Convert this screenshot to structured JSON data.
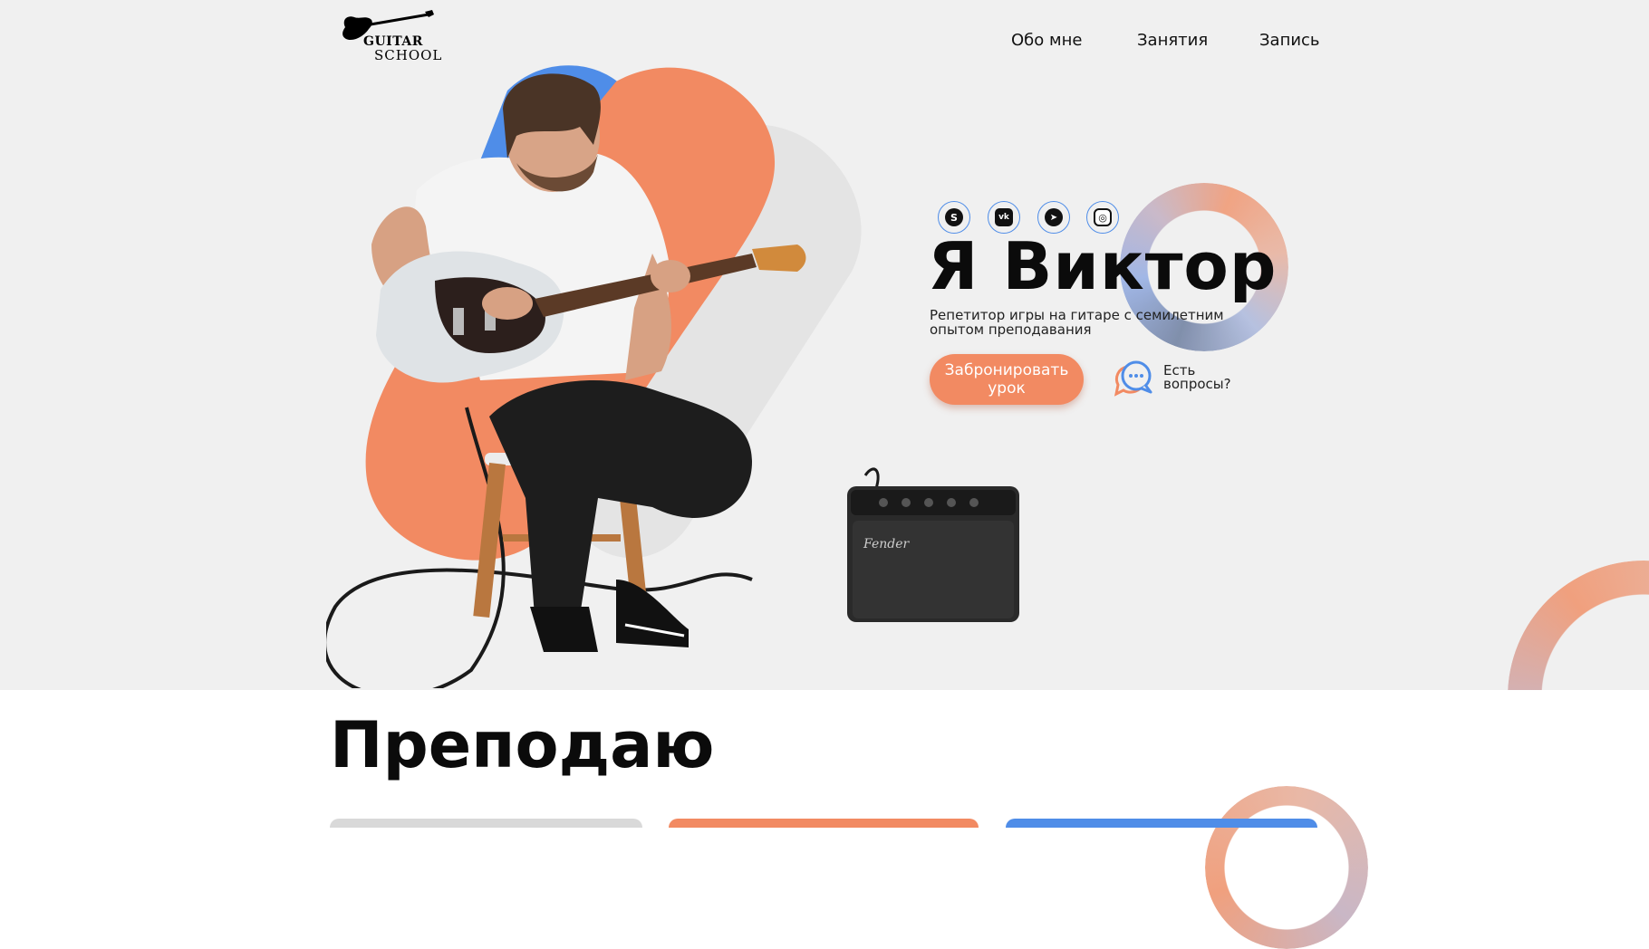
{
  "header": {
    "logo": {
      "line1": "GUITAR",
      "line2": "SCHOOL"
    },
    "nav": [
      {
        "label": "Обо мне"
      },
      {
        "label": "Занятия"
      },
      {
        "label": "Запись"
      }
    ]
  },
  "hero": {
    "socials": [
      {
        "icon": "skype-icon",
        "glyph": "S"
      },
      {
        "icon": "vk-icon",
        "glyph": "vk"
      },
      {
        "icon": "telegram-icon",
        "glyph": "➤"
      },
      {
        "icon": "instagram-icon",
        "glyph": "◎"
      }
    ],
    "title": "Я Виктор",
    "subtitle": "Репетитор игры на гитаре с семилетним опытом преподавания",
    "cta_label": "Забронировать урок",
    "questions_label": "Есть вопросы?"
  },
  "section": {
    "title": "Преподаю"
  },
  "colors": {
    "accent_orange": "#f28a62",
    "accent_blue": "#4f8de8",
    "hero_bg": "#f0f0f0",
    "text": "#0b0b0b"
  }
}
